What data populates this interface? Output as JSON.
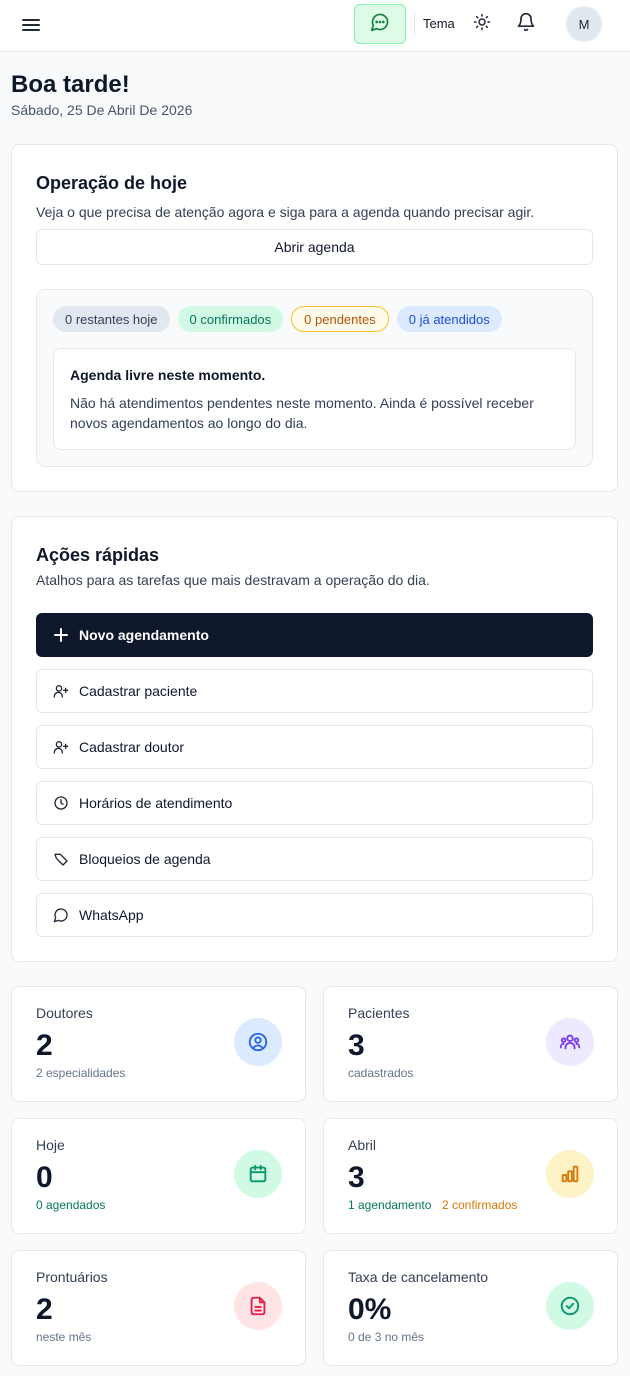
{
  "header": {
    "chat_icon": "chat-bubble-icon",
    "theme_label": "Tema",
    "avatar_initial": "M",
    "accent": "#16a34a"
  },
  "greeting": {
    "title": "Boa tarde!",
    "date": "Sábado, 25 De Abril De 2026"
  },
  "operation": {
    "title": "Operação de hoje",
    "description": "Veja o que precisa de atenção agora e siga para a agenda quando precisar agir.",
    "open_button": "Abrir agenda",
    "badges": {
      "remaining": "0 restantes hoje",
      "confirmed": "0 confirmados",
      "pending": "0 pendentes",
      "attended": "0 já atendidos"
    },
    "free_title": "Agenda livre neste momento.",
    "free_text": "Não há atendimentos pendentes neste momento. Ainda é possível receber novos agendamentos ao longo do dia."
  },
  "quick_actions": {
    "title": "Ações rápidas",
    "description": "Atalhos para as tarefas que mais destravam a operação do dia.",
    "items": [
      {
        "label": "Novo agendamento",
        "icon": "plus-icon"
      },
      {
        "label": "Cadastrar paciente",
        "icon": "user-plus-icon"
      },
      {
        "label": "Cadastrar doutor",
        "icon": "user-plus-icon"
      },
      {
        "label": "Horários de atendimento",
        "icon": "clock-icon"
      },
      {
        "label": "Bloqueios de agenda",
        "icon": "tag-icon"
      },
      {
        "label": "WhatsApp",
        "icon": "chat-bubble-icon"
      }
    ]
  },
  "stats": {
    "doctors": {
      "label": "Doutores",
      "value": "2",
      "sub": "2 especialidades",
      "icon": "user-circle-icon"
    },
    "patients": {
      "label": "Pacientes",
      "value": "3",
      "sub": "cadastrados",
      "icon": "users-group-icon"
    },
    "today": {
      "label": "Hoje",
      "value": "0",
      "sub": "0 agendados",
      "icon": "calendar-icon"
    },
    "month": {
      "label": "Abril",
      "value": "3",
      "sub": "1 agendamento",
      "sub2": "2 confirmados",
      "icon": "bar-chart-icon"
    },
    "records": {
      "label": "Prontuários",
      "value": "2",
      "sub": "neste mês",
      "icon": "document-icon"
    },
    "cancel_rate": {
      "label": "Taxa de cancelamento",
      "value": "0%",
      "sub": "0 de 3 no mês",
      "icon": "check-circle-icon"
    }
  }
}
